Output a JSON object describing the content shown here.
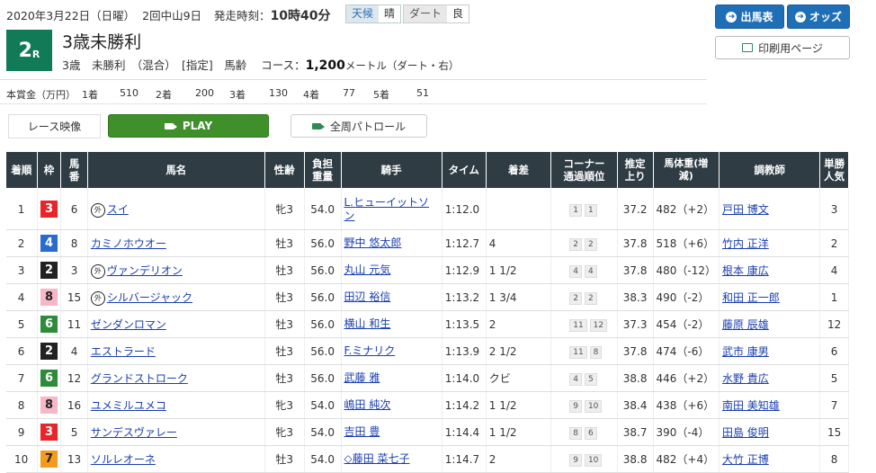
{
  "header": {
    "date": "2020年3月22日（日曜）",
    "meeting": "2回中山9日",
    "post_time_label": "発走時刻：",
    "post_time": "10時40分",
    "weather_label": "天候",
    "weather": "晴",
    "track_label": "ダート",
    "track_cond": "良"
  },
  "race": {
    "num": "2",
    "suffix": "R",
    "name": "3歳未勝利",
    "cond1": "3歳　未勝利　（混合）　[指定]　馬齢",
    "course_label": "コース：",
    "distance": "1,200",
    "unit": "メートル（ダート・右）"
  },
  "prize": {
    "label": "本賞金（万円）",
    "items": [
      "1着",
      "510",
      "2着",
      "200",
      "3着",
      "130",
      "4着",
      "77",
      "5着",
      "51"
    ]
  },
  "buttons": {
    "shutsuba": "出馬表",
    "odds": "オッズ",
    "print": "印刷用ページ",
    "race_video": "レース映像",
    "play": "PLAY",
    "patrol": "全周パトロール"
  },
  "table": {
    "headers": [
      "着順",
      "枠",
      "馬番",
      "馬名",
      "性齢",
      "負担重量",
      "騎手",
      "タイム",
      "着差",
      "コーナー通過順位",
      "推定上り",
      "馬体重(増減)",
      "調教師",
      "単勝人気"
    ],
    "rows": [
      {
        "rank": "1",
        "frame": "3",
        "num": "6",
        "name": "スイ",
        "gai": true,
        "sex": "牝3",
        "wt": "54.0",
        "jockey": "L.ヒューイットソン",
        "time": "1:12.0",
        "margin": "",
        "c1": "1",
        "c2": "1",
        "agari": "37.2",
        "bw": "482（+2）",
        "trainer": "戸田 博文",
        "pop": "3"
      },
      {
        "rank": "2",
        "frame": "4",
        "num": "8",
        "name": "カミノホウオー",
        "gai": false,
        "sex": "牡3",
        "wt": "56.0",
        "jockey": "野中 悠太郎",
        "time": "1:12.7",
        "margin": "4",
        "c1": "2",
        "c2": "2",
        "agari": "37.8",
        "bw": "518（+6）",
        "trainer": "竹内 正洋",
        "pop": "2"
      },
      {
        "rank": "3",
        "frame": "2",
        "num": "3",
        "name": "ヴァンデリオン",
        "gai": true,
        "sex": "牡3",
        "wt": "56.0",
        "jockey": "丸山 元気",
        "time": "1:12.9",
        "margin": "1 1/2",
        "c1": "4",
        "c2": "4",
        "agari": "37.8",
        "bw": "480（-12）",
        "trainer": "根本 康広",
        "pop": "4"
      },
      {
        "rank": "4",
        "frame": "8",
        "num": "15",
        "name": "シルバージャック",
        "gai": true,
        "sex": "牡3",
        "wt": "56.0",
        "jockey": "田辺 裕信",
        "time": "1:13.2",
        "margin": "1 3/4",
        "c1": "2",
        "c2": "2",
        "agari": "38.3",
        "bw": "490（-2）",
        "trainer": "和田 正一郎",
        "pop": "1"
      },
      {
        "rank": "5",
        "frame": "6",
        "num": "11",
        "name": "ゼンダンロマン",
        "gai": false,
        "sex": "牡3",
        "wt": "56.0",
        "jockey": "横山 和生",
        "time": "1:13.5",
        "margin": "2",
        "c1": "11",
        "c2": "12",
        "agari": "37.3",
        "bw": "454（-2）",
        "trainer": "藤原 辰雄",
        "pop": "12"
      },
      {
        "rank": "6",
        "frame": "2",
        "num": "4",
        "name": "エストラード",
        "gai": false,
        "sex": "牡3",
        "wt": "56.0",
        "jockey": "F.ミナリク",
        "time": "1:13.9",
        "margin": "2 1/2",
        "c1": "11",
        "c2": "8",
        "agari": "37.8",
        "bw": "474（-6）",
        "trainer": "武市 康男",
        "pop": "6"
      },
      {
        "rank": "7",
        "frame": "6",
        "num": "12",
        "name": "グランドストローク",
        "gai": false,
        "sex": "牡3",
        "wt": "56.0",
        "jockey": "武藤 雅",
        "time": "1:14.0",
        "margin": "クビ",
        "c1": "4",
        "c2": "5",
        "agari": "38.8",
        "bw": "446（+2）",
        "trainer": "水野 貴広",
        "pop": "5"
      },
      {
        "rank": "8",
        "frame": "8",
        "num": "16",
        "name": "ユメミルユメコ",
        "gai": false,
        "sex": "牝3",
        "wt": "54.0",
        "jockey": "嶋田 純次",
        "time": "1:14.2",
        "margin": "1 1/2",
        "c1": "9",
        "c2": "10",
        "agari": "38.4",
        "bw": "438（+6）",
        "trainer": "南田 美知雄",
        "pop": "7"
      },
      {
        "rank": "9",
        "frame": "3",
        "num": "5",
        "name": "サンデスヴァレー",
        "gai": false,
        "sex": "牝3",
        "wt": "54.0",
        "jockey": "吉田 豊",
        "time": "1:14.4",
        "margin": "1 1/2",
        "c1": "8",
        "c2": "6",
        "agari": "38.7",
        "bw": "390（-4）",
        "trainer": "田島 俊明",
        "pop": "15"
      },
      {
        "rank": "10",
        "frame": "7",
        "num": "13",
        "name": "ソルレオーネ",
        "gai": false,
        "sex": "牡3",
        "wt": "54.0",
        "jockey": "◇藤田 菜七子",
        "time": "1:14.7",
        "margin": "2",
        "c1": "9",
        "c2": "10",
        "agari": "38.8",
        "bw": "482（+4）",
        "trainer": "大竹 正博",
        "pop": "8"
      }
    ]
  },
  "frame_colors": {
    "1": {
      "bg": "#ffffff",
      "fg": "#222222"
    },
    "2": {
      "bg": "#222222",
      "fg": "#ffffff"
    },
    "3": {
      "bg": "#e8262a",
      "fg": "#ffffff"
    },
    "4": {
      "bg": "#2a6bd1",
      "fg": "#ffffff"
    },
    "5": {
      "bg": "#f3d300",
      "fg": "#222222"
    },
    "6": {
      "bg": "#2e8b3a",
      "fg": "#ffffff"
    },
    "7": {
      "bg": "#f39a1f",
      "fg": "#222222"
    },
    "8": {
      "bg": "#f6b7c8",
      "fg": "#222222"
    }
  },
  "icons": {
    "gai": "外",
    "video_icon": "video-camera-icon"
  }
}
